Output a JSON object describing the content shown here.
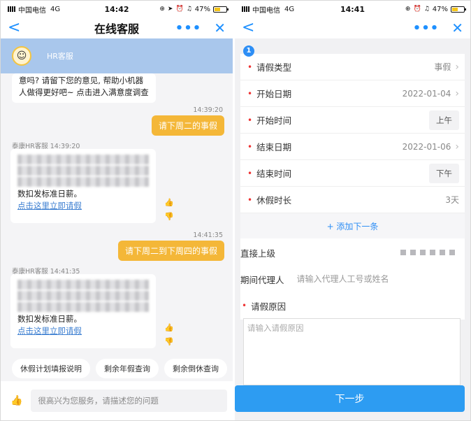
{
  "left": {
    "status": {
      "carrier": "中国电信",
      "network": "4G",
      "time": "14:42",
      "battery": "47%",
      "battery_level": 0.47
    },
    "nav": {
      "title": "在线客服",
      "back": "<",
      "more": "•••",
      "close": "✕"
    },
    "bot_name": "HR客服",
    "first_card_text": "意吗? 请留下您的意见, 帮助小机器人做得更好吧~ 点击进入满意度调查",
    "messages": [
      {
        "time": "14:39:20",
        "user_text": "请下周二的事假",
        "bot_header": "泰康HR客服  14:39:20",
        "bot_tail": "数扣发标准日薪。",
        "bot_link": "点击这里立即请假"
      },
      {
        "time": "14:41:35",
        "user_text": "请下周二到下周四的事假",
        "bot_header": "泰康HR客服  14:41:35",
        "bot_tail": "数扣发标准日薪。",
        "bot_link": "点击这里立即请假"
      }
    ],
    "quick_replies": [
      "休假计划填报说明",
      "剩余年假查询",
      "剩余倒休查询"
    ],
    "input_placeholder": "很高兴为您服务，请描述您的问题"
  },
  "right": {
    "status": {
      "carrier": "中国电信",
      "network": "4G",
      "time": "14:41",
      "battery": "47%",
      "battery_level": 0.47
    },
    "nav": {
      "back": "<",
      "more": "•••",
      "close": "✕"
    },
    "step_number": "1",
    "rows": [
      {
        "label": "请假类型",
        "value": "事假",
        "kind": "select"
      },
      {
        "label": "开始日期",
        "value": "2022-01-04",
        "kind": "select"
      },
      {
        "label": "开始时间",
        "value": "上午",
        "kind": "pill"
      },
      {
        "label": "结束日期",
        "value": "2022-01-06",
        "kind": "select"
      },
      {
        "label": "结束时间",
        "value": "下午",
        "kind": "pill"
      },
      {
        "label": "休假时长",
        "value": "3天",
        "kind": "static"
      }
    ],
    "add_next": "+ 添加下一条",
    "supervisor_label": "直接上级",
    "agent_label": "期间代理人",
    "agent_placeholder": "请输入代理人工号或姓名",
    "reason_label": "请假原因",
    "reason_placeholder": "请输入请假原因",
    "next_button": "下一步"
  },
  "colors": {
    "accent": "#2d9cf2",
    "user_bubble": "#f4b738",
    "required": "#e33333"
  }
}
